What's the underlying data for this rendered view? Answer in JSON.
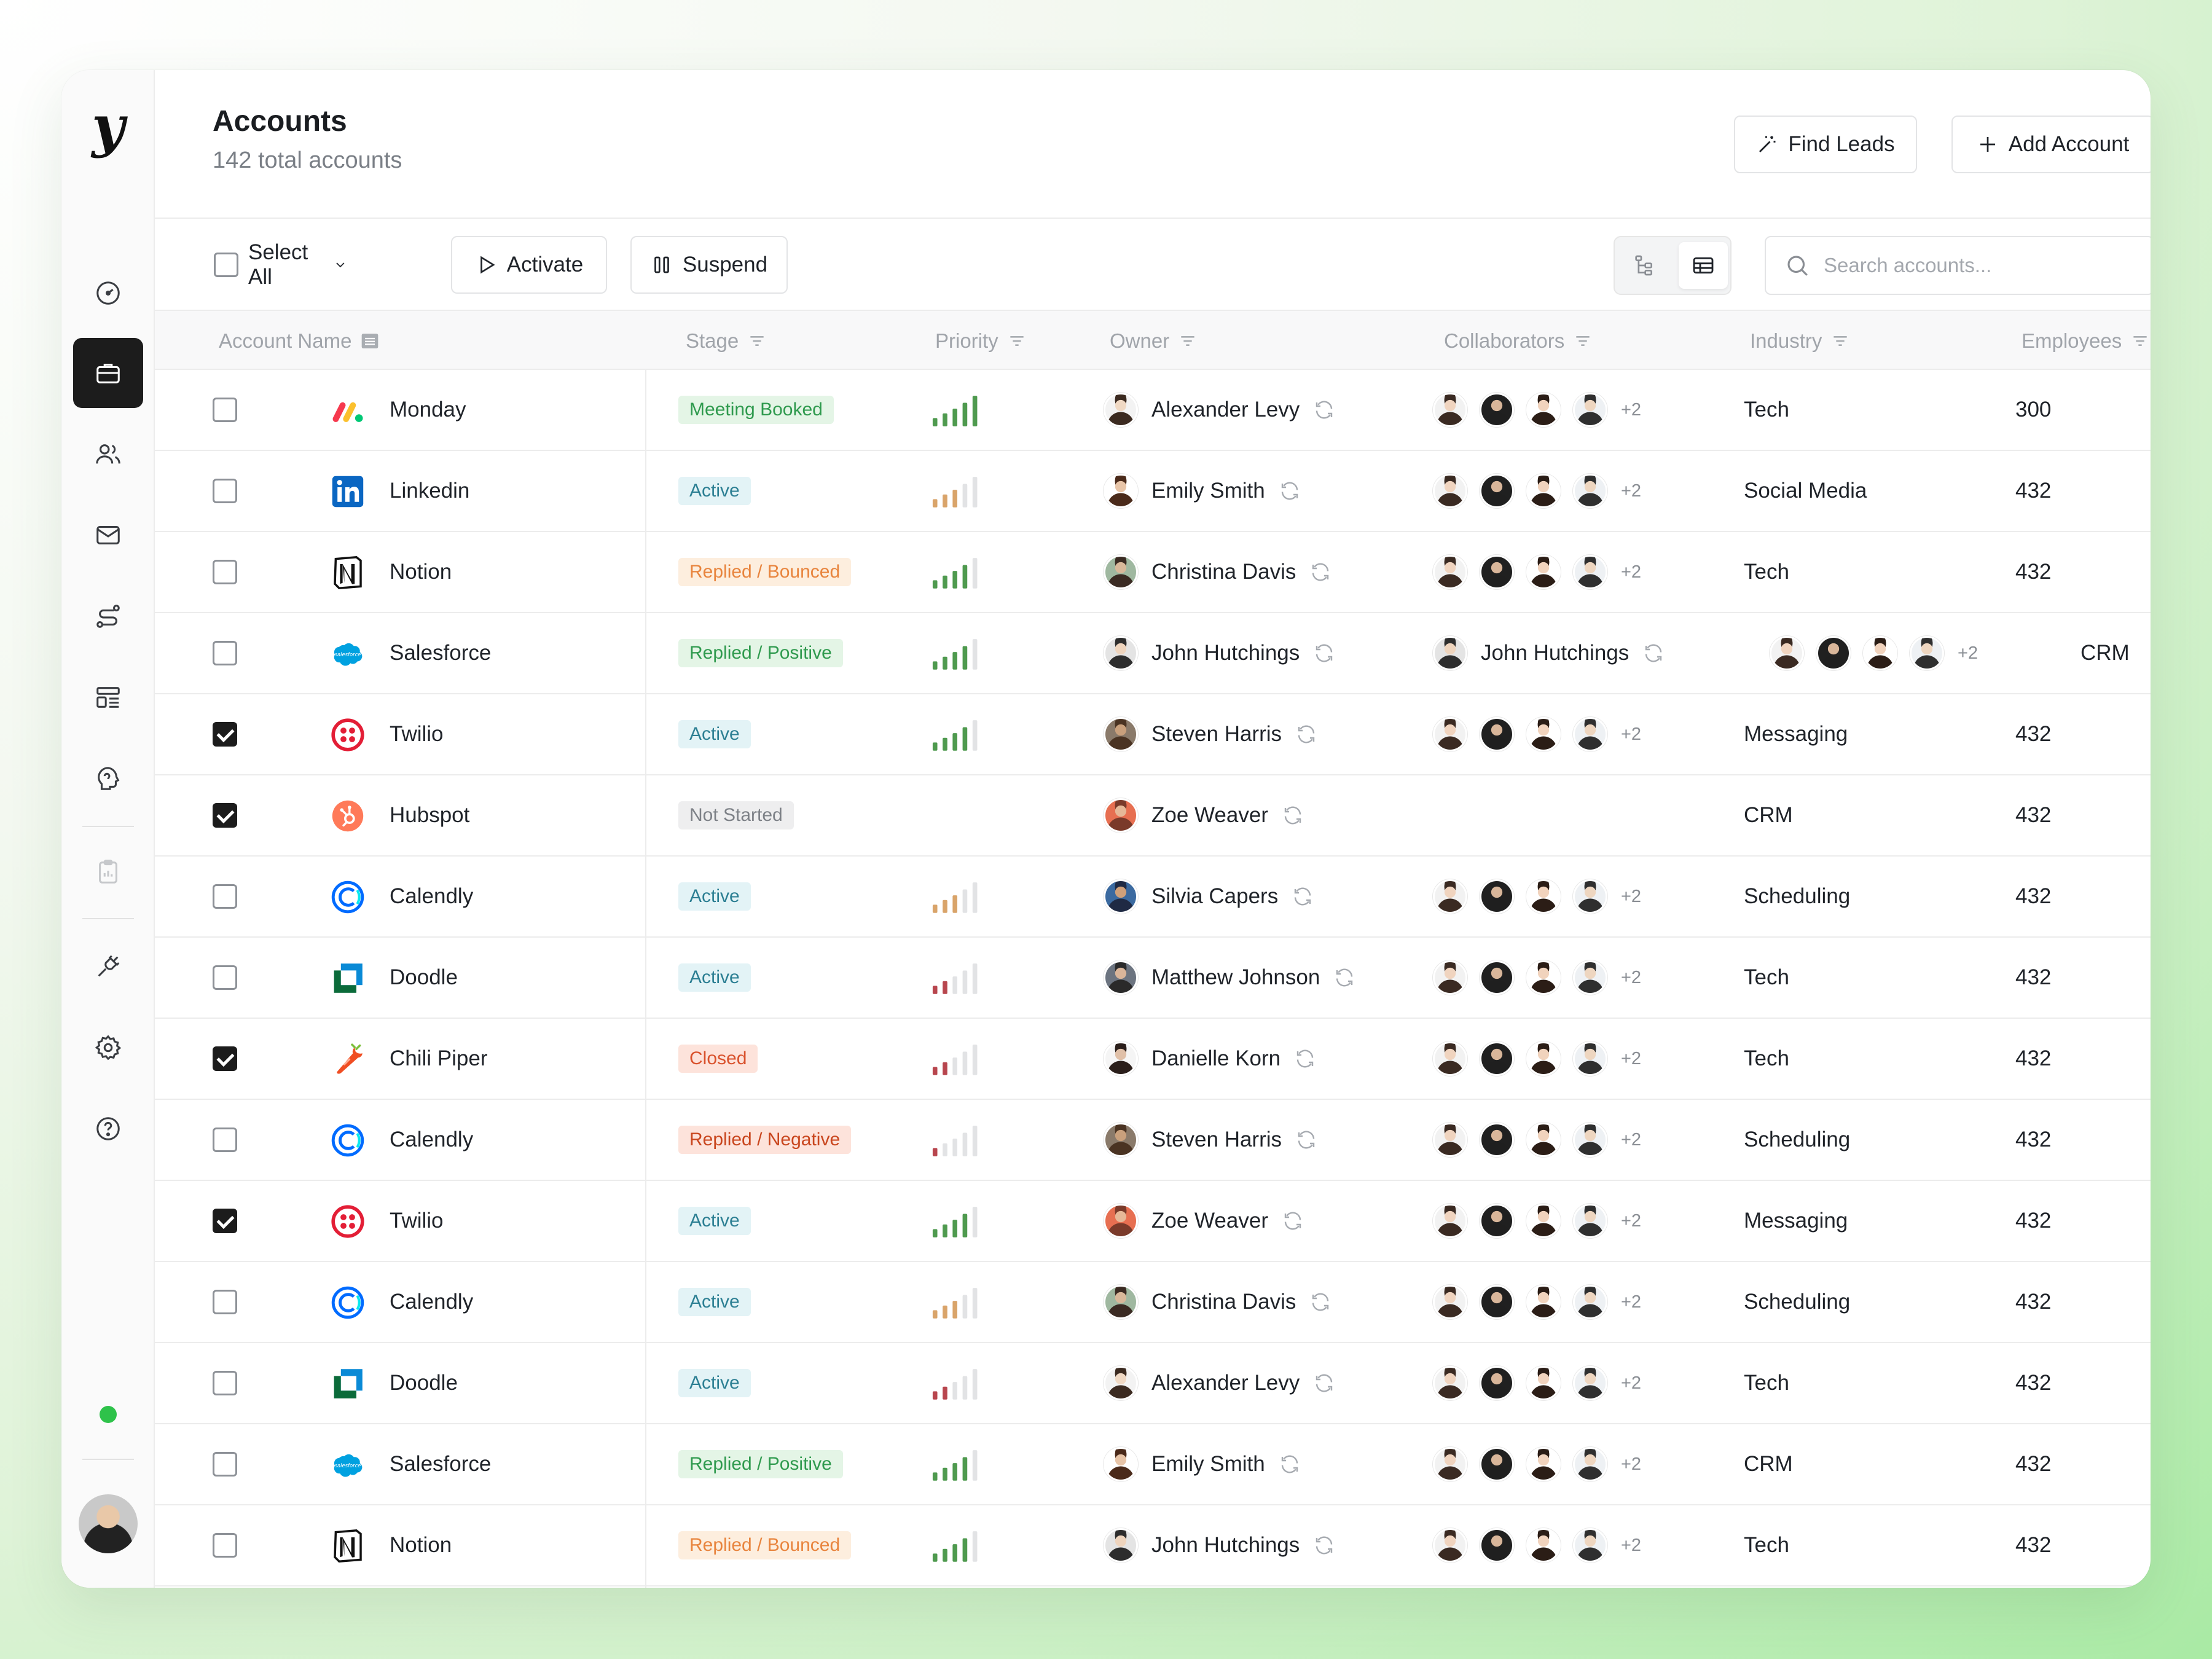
{
  "page": {
    "title": "Accounts",
    "subtitle": "142 total accounts",
    "find_leads": "Find Leads",
    "add_account": "Add Account"
  },
  "toolbar": {
    "select_all": "Select All",
    "activate": "Activate",
    "suspend": "Suspend",
    "search_placeholder": "Search accounts..."
  },
  "columns": {
    "account_name": "Account Name",
    "stage": "Stage",
    "priority": "Priority",
    "owner": "Owner",
    "collaborators": "Collaborators",
    "industry": "Industry",
    "employees": "Employees"
  },
  "collaborators_more": "+2",
  "colors": {
    "accent_dark": "#1c1c1c",
    "online": "#2ec24a",
    "priority_high": "#4f9a4f",
    "priority_mid": "#d9a46a",
    "priority_low": "#b8464e"
  },
  "stage_styles": {
    "Meeting Booked": {
      "bg": "#e4f5e6",
      "fg": "#2f9a4e"
    },
    "Active": {
      "bg": "#e3f3f6",
      "fg": "#2c7f93"
    },
    "Replied / Bounced": {
      "bg": "#fdeede",
      "fg": "#e8843d"
    },
    "Replied / Positive": {
      "bg": "#e4f5e6",
      "fg": "#2f9a4e"
    },
    "Not Started": {
      "bg": "#eeeeef",
      "fg": "#7d8187"
    },
    "Closed": {
      "bg": "#fde3db",
      "fg": "#d9522d"
    },
    "Replied / Negative": {
      "bg": "#fde3db",
      "fg": "#c9461e"
    }
  },
  "rows": [
    {
      "checked": false,
      "logo": "monday-logo",
      "name": "Monday",
      "stage": "Meeting Booked",
      "priority": 5,
      "owner": "Alexander Levy",
      "industry": "Tech",
      "employees": "300"
    },
    {
      "checked": false,
      "logo": "linkedin-logo",
      "name": "Linkedin",
      "stage": "Active",
      "priority": 3,
      "owner": "Emily Smith",
      "industry": "Social Media",
      "employees": "432"
    },
    {
      "checked": false,
      "logo": "notion-logo",
      "name": "Notion",
      "stage": "Replied / Bounced",
      "priority": 4,
      "owner": "Christina Davis",
      "industry": "Tech",
      "employees": "432"
    },
    {
      "checked": false,
      "logo": "salesforce-logo",
      "name": "Salesforce",
      "stage": "Replied / Positive",
      "priority": 4,
      "owner": "John Hutchings",
      "owner2": "John Hutchings",
      "industry": "CRM",
      "employees": ""
    },
    {
      "checked": true,
      "logo": "twilio-logo",
      "name": "Twilio",
      "stage": "Active",
      "priority": 4,
      "owner": "Steven Harris",
      "industry": "Messaging",
      "employees": "432"
    },
    {
      "checked": true,
      "logo": "hubspot-logo",
      "name": "Hubspot",
      "stage": "Not Started",
      "priority": 0,
      "owner": "Zoe Weaver",
      "industry": "CRM",
      "employees": "432"
    },
    {
      "checked": false,
      "logo": "calendly-logo",
      "name": "Calendly",
      "stage": "Active",
      "priority": 3,
      "owner": "Silvia Capers",
      "industry": "Scheduling",
      "employees": "432"
    },
    {
      "checked": false,
      "logo": "doodle-logo",
      "name": "Doodle",
      "stage": "Active",
      "priority": 2,
      "owner": "Matthew Johnson",
      "industry": "Tech",
      "employees": "432"
    },
    {
      "checked": true,
      "logo": "chilipiper-logo",
      "name": "Chili Piper",
      "stage": "Closed",
      "priority": 2,
      "owner": "Danielle Korn",
      "industry": "Tech",
      "employees": "432"
    },
    {
      "checked": false,
      "logo": "calendly-logo",
      "name": "Calendly",
      "stage": "Replied / Negative",
      "priority": 1,
      "owner": "Steven Harris",
      "industry": "Scheduling",
      "employees": "432"
    },
    {
      "checked": true,
      "logo": "twilio-logo",
      "name": "Twilio",
      "stage": "Active",
      "priority": 4,
      "owner": "Zoe Weaver",
      "industry": "Messaging",
      "employees": "432"
    },
    {
      "checked": false,
      "logo": "calendly-logo",
      "name": "Calendly",
      "stage": "Active",
      "priority": 3,
      "owner": "Christina Davis",
      "industry": "Scheduling",
      "employees": "432"
    },
    {
      "checked": false,
      "logo": "doodle-logo",
      "name": "Doodle",
      "stage": "Active",
      "priority": 2,
      "owner": "Alexander Levy",
      "industry": "Tech",
      "employees": "432"
    },
    {
      "checked": false,
      "logo": "salesforce-logo",
      "name": "Salesforce",
      "stage": "Replied / Positive",
      "priority": 4,
      "owner": "Emily Smith",
      "industry": "CRM",
      "employees": "432"
    },
    {
      "checked": false,
      "logo": "notion-logo",
      "name": "Notion",
      "stage": "Replied / Bounced",
      "priority": 4,
      "owner": "John Hutchings",
      "industry": "Tech",
      "employees": "432"
    }
  ]
}
